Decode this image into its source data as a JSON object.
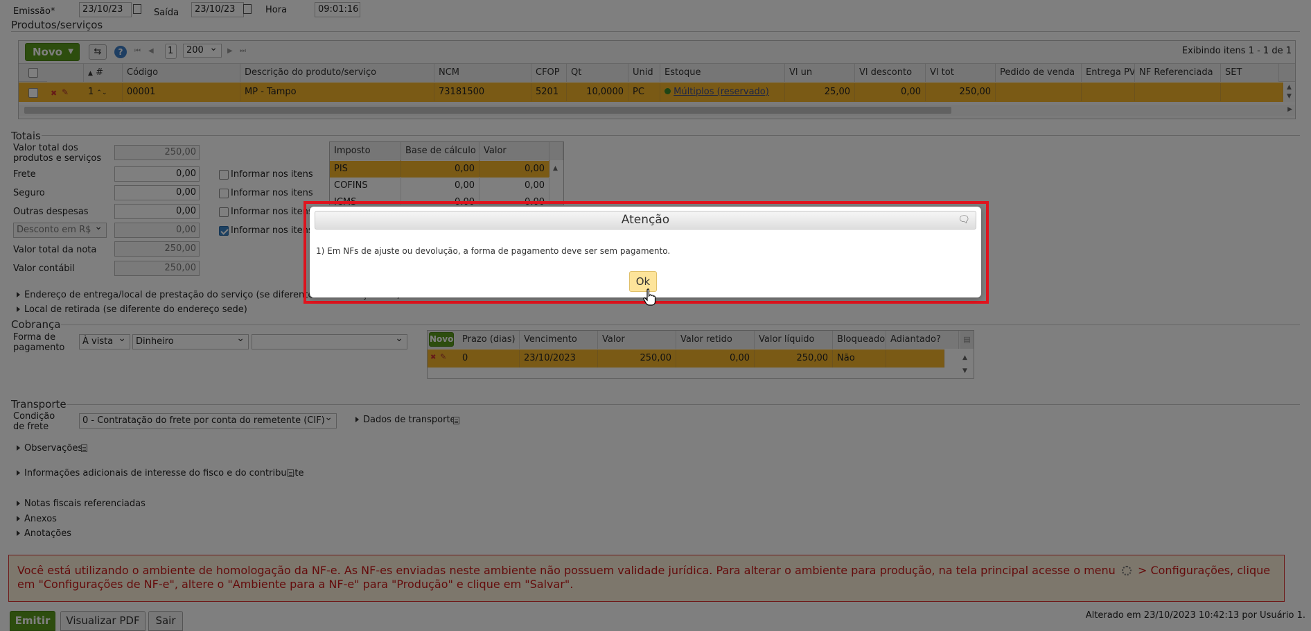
{
  "header": {
    "emissao_label": "Emissão*",
    "emissao_value": "23/10/23",
    "saida_label": "Saída",
    "saida_value": "23/10/23",
    "hora_label": "Hora",
    "hora_value": "09:01:16"
  },
  "produtos": {
    "section_title": "Produtos/serviços",
    "novo_label": "Novo",
    "page_number": "1",
    "page_size": "200",
    "showing_text": "Exibindo itens 1 - 1 de 1",
    "columns": [
      "#",
      "Código",
      "Descrição do produto/serviço",
      "NCM",
      "CFOP",
      "Qt",
      "Unid",
      "Estoque",
      "Vl un",
      "Vl desconto",
      "Vl tot",
      "Pedido de venda",
      "Entrega PV",
      "NF Referenciada",
      "SET"
    ],
    "row": {
      "num": "1",
      "codigo": "00001",
      "descricao": "MP - Tampo",
      "ncm": "73181500",
      "cfop": "5201",
      "qt": "10,0000",
      "unid": "PC",
      "estoque": "Múltiplos (reservado)",
      "vl_un": "25,00",
      "vl_desconto": "0,00",
      "vl_tot": "250,00"
    }
  },
  "totais": {
    "section_title": "Totais",
    "valor_total_label": "Valor total dos produtos e serviços",
    "valor_total_value": "250,00",
    "frete_label": "Frete",
    "frete_value": "0,00",
    "seguro_label": "Seguro",
    "seguro_value": "0,00",
    "outras_label": "Outras despesas",
    "outras_value": "0,00",
    "desconto_select": "Desconto em R$",
    "desconto_value": "0,00",
    "valor_nota_label": "Valor total da nota",
    "valor_nota_value": "250,00",
    "valor_contabil_label": "Valor contábil",
    "valor_contabil_value": "250,00",
    "informar_label": "Informar nos itens"
  },
  "impostos": {
    "columns": [
      "Imposto",
      "Base de cálculo",
      "Valor"
    ],
    "rows": [
      {
        "imposto": "PIS",
        "base": "0,00",
        "valor": "0,00"
      },
      {
        "imposto": "COFINS",
        "base": "0,00",
        "valor": "0,00"
      },
      {
        "imposto": "ICMS",
        "base": "0,00",
        "valor": "0,00"
      }
    ]
  },
  "links": {
    "endereco_entrega": "Endereço de entrega/local de prestação do serviço (se diferente do endereço sede)",
    "local_retirada": "Local de retirada (se diferente do endereço sede)"
  },
  "cobranca": {
    "section_title": "Cobrança",
    "forma_label": "Forma de pagamento",
    "forma_select": "À vista",
    "meio_select": "Dinheiro",
    "extra_select": "",
    "novo_label": "Novo",
    "columns": [
      "Prazo (dias)",
      "Vencimento",
      "Valor",
      "Valor retido",
      "Valor líquido",
      "Bloqueado",
      "Adiantado?"
    ],
    "row": {
      "prazo": "0",
      "vencimento": "23/10/2023",
      "valor": "250,00",
      "retido": "0,00",
      "liquido": "250,00",
      "bloqueado": "Não",
      "adiantado": ""
    }
  },
  "transporte": {
    "section_title": "Transporte",
    "condicao_label": "Condição de frete",
    "condicao_value": "0 - Contratação do frete por conta do remetente (CIF)",
    "dados_label": "Dados de transporte"
  },
  "expanders": {
    "observacoes": "Observações",
    "informacoes": "Informações adicionais de interesse do fisco e do contribuinte",
    "notas": "Notas fiscais referenciadas",
    "anexos": "Anexos",
    "anotacoes": "Anotações"
  },
  "warning": {
    "text_before": "Você está utilizando o ambiente de homologação da NF-e. As NF-es enviadas neste ambiente não possuem validade jurídica. Para alterar o ambiente para produção, na tela principal acesse o menu",
    "text_after": "> Configurações, clique em \"Configurações de NF-e\", altere o \"Ambiente para a NF-e\" para \"Produção\" e clique em \"Salvar\"."
  },
  "footer": {
    "emitir_label": "Emitir",
    "pdf_label": "Visualizar PDF",
    "sair_label": "Sair",
    "altered_text": "Alterado em 23/10/2023 10:42:13 por Usuário 1."
  },
  "dialog": {
    "title": "Atenção",
    "message": "1) Em NFs de ajuste ou devolução, a forma de pagamento deve ser sem pagamento.",
    "ok_label": "Ok"
  },
  "colors": {
    "row_highlight": "#f5b52b",
    "accent_green": "#5a9b1c",
    "warning_red": "#c81818",
    "dialog_border": "#e0141e"
  }
}
